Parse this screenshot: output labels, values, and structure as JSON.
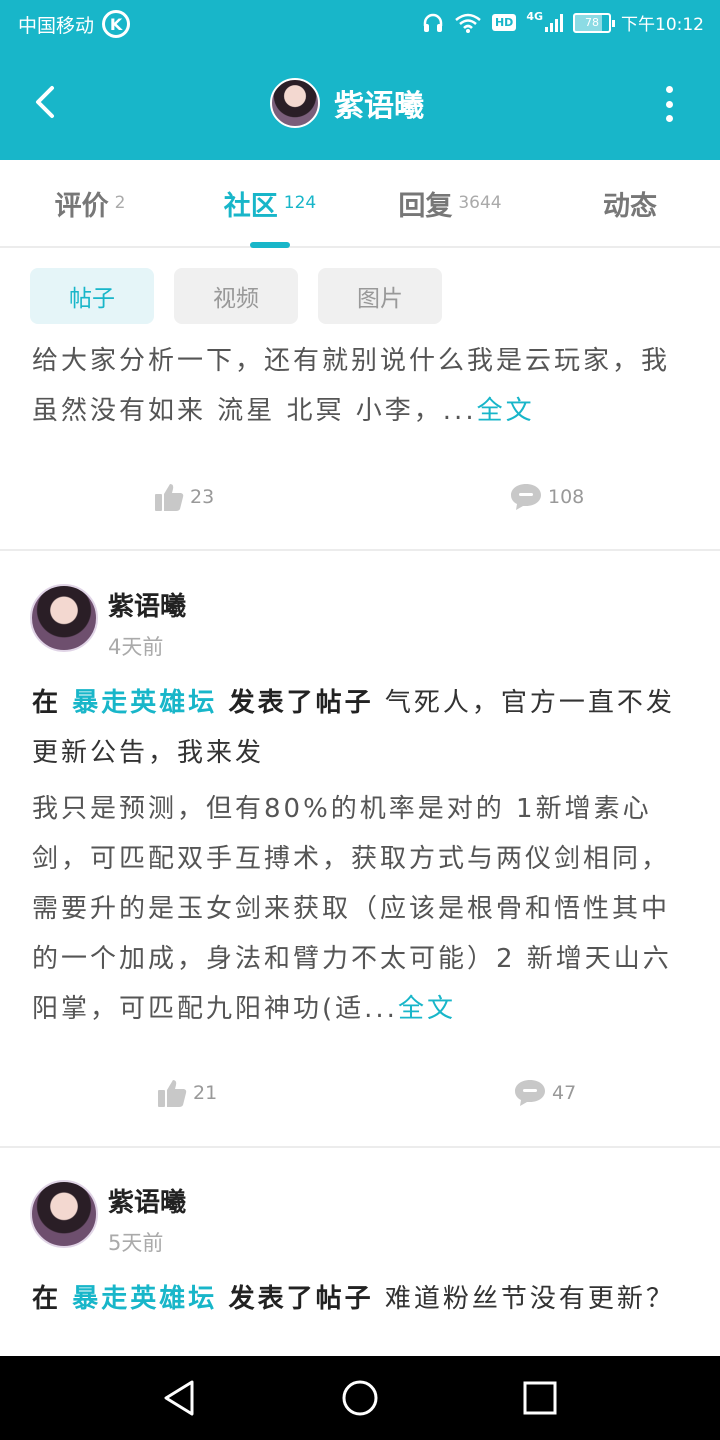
{
  "status_bar": {
    "carrier": "中国移动",
    "carrier_badge": "K",
    "hd": "HD",
    "network": "4G",
    "battery_level": "78",
    "battery_fraction": 0.78,
    "time": "下午10:12"
  },
  "header": {
    "title": "紫语曦",
    "back_icon": "chevron-left-icon",
    "more_icon": "more-vertical-icon"
  },
  "tabs": [
    {
      "label": "评价",
      "count": "2"
    },
    {
      "label": "社区",
      "count": "124"
    },
    {
      "label": "回复",
      "count": "3644"
    },
    {
      "label": "动态",
      "count": ""
    }
  ],
  "chips": [
    "帖子",
    "视频",
    "图片"
  ],
  "posts": [
    {
      "body": "给大家分析一下，还有就别说什么我是云玩家，我虽然没有如来 流星 北冥 小李，...",
      "more": "全文",
      "likes": "23",
      "comments": "108"
    },
    {
      "author": "紫语曦",
      "time": "4天前",
      "prefix": "在",
      "forum": "暴走英雄坛",
      "action": "发表了帖子",
      "headline": "气死人，官方一直不发更新公告，我来发",
      "body": "我只是预测，但有80%的机率是对的 1新增素心剑，可匹配双手互搏术，获取方式与两仪剑相同，需要升的是玉女剑来获取（应该是根骨和悟性其中的一个加成，身法和臂力不太可能）2 新增天山六阳掌，可匹配九阳神功(适...",
      "more": "全文",
      "likes": "21",
      "comments": "47"
    },
    {
      "author": "紫语曦",
      "time": "5天前",
      "prefix": "在",
      "forum": "暴走英雄坛",
      "action": "发表了帖子",
      "headline": "难道粉丝节没有更新？"
    }
  ],
  "colors": {
    "accent": "#18b6c9",
    "chip_active_bg": "#e5f5f8"
  }
}
